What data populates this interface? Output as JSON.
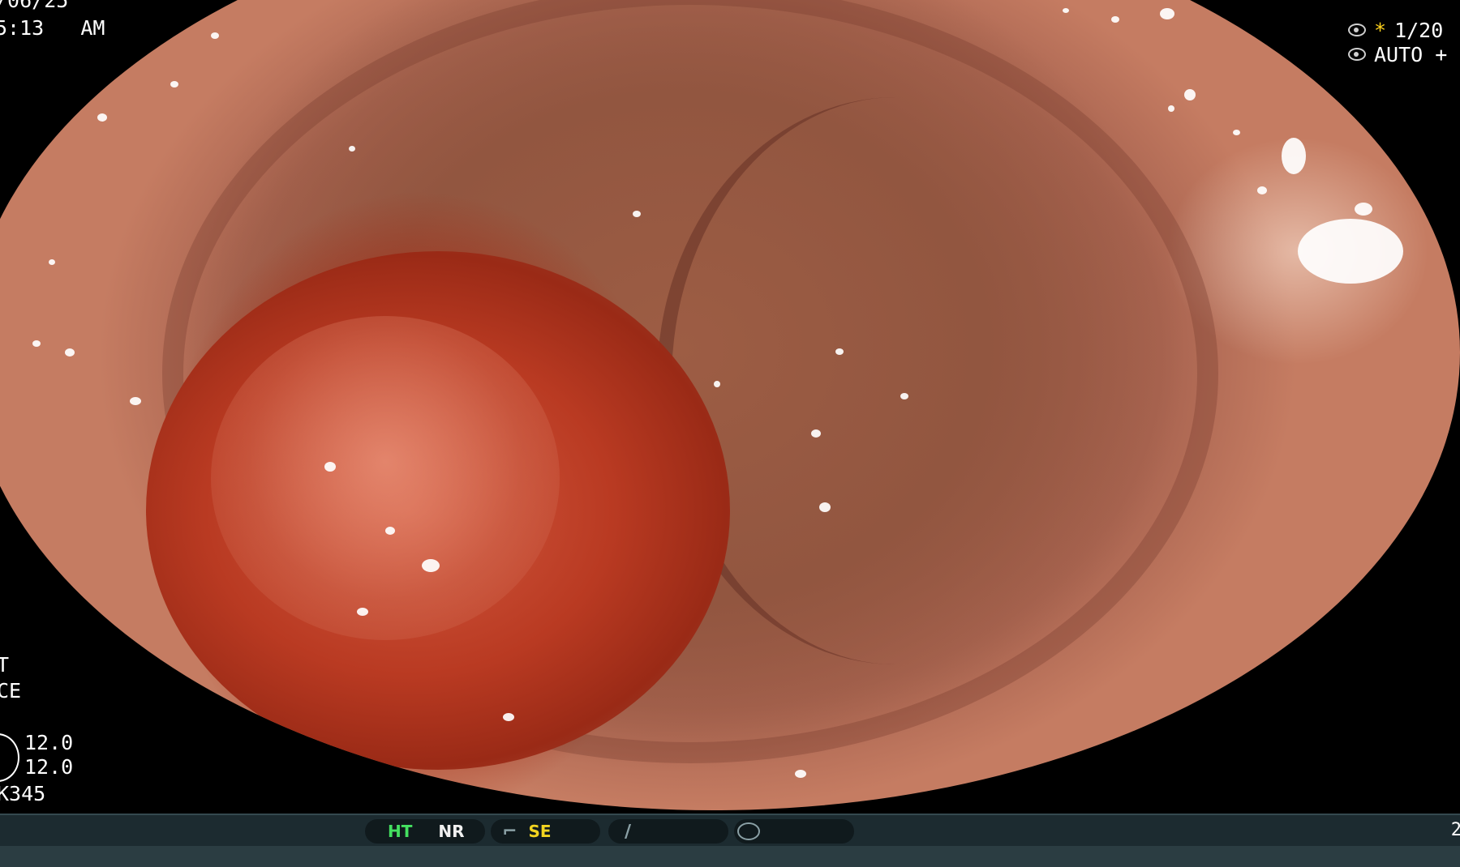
{
  "osd": {
    "date": "/06/25",
    "time": "5:13   AM",
    "shutter": "1/20",
    "star": "*",
    "mode": "AUTO +"
  },
  "left_panel": {
    "line1": "T",
    "line2": "CE",
    "value1": "12.0",
    "value2": "12.0",
    "code": "K345"
  },
  "status_bar": {
    "ht": "HT",
    "nr": "NR",
    "se": "SE",
    "icon_1": "curve-icon",
    "icon_2": "slash-curve-icon",
    "icon_3": "scope-icon",
    "right_char": "2"
  },
  "colors": {
    "ht": "#44e060",
    "se": "#f2d420",
    "star": "#ffd21c",
    "bar": "#1c2b30"
  }
}
